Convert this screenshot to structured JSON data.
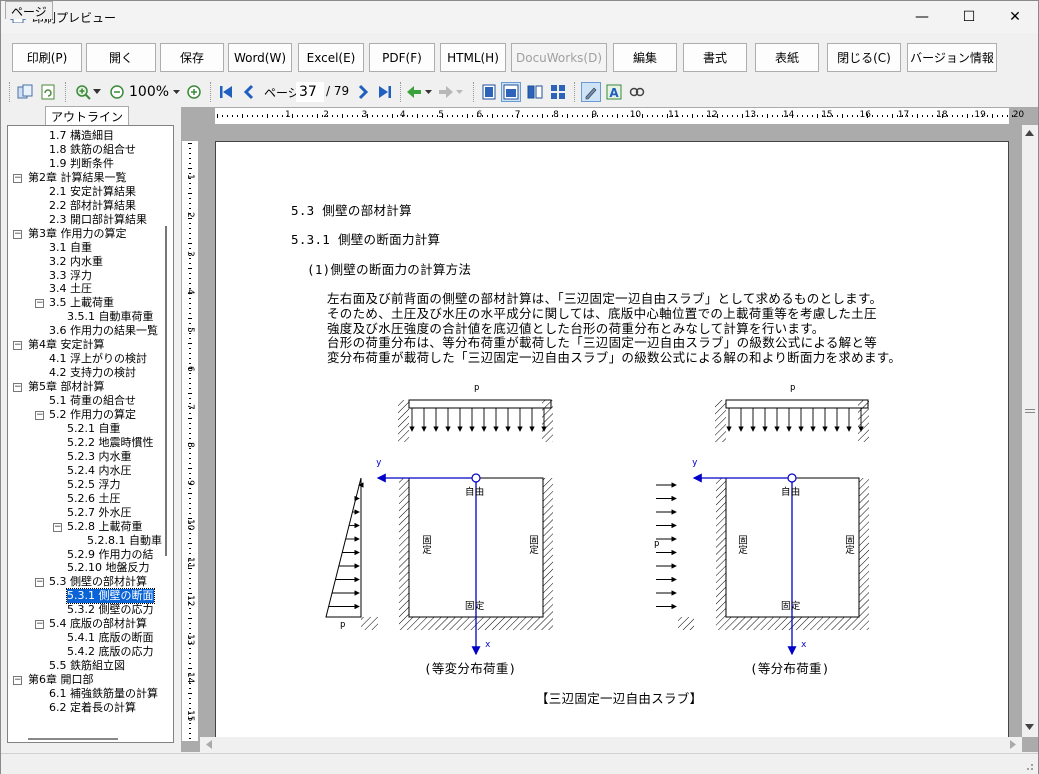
{
  "window": {
    "title": "印刷プレビュー",
    "minimize": "—",
    "maximize": "☐",
    "close": "✕"
  },
  "buttons": [
    {
      "label": "印刷(P)",
      "enabled": true
    },
    {
      "label": "開く",
      "enabled": true
    },
    {
      "label": "保存",
      "enabled": true
    },
    {
      "label": "Word(W)",
      "enabled": true
    },
    {
      "label": "Excel(E)",
      "enabled": true
    },
    {
      "label": "PDF(F)",
      "enabled": true
    },
    {
      "label": "HTML(H)",
      "enabled": true
    },
    {
      "label": "DocuWorks(D)",
      "enabled": false
    },
    {
      "label": "編集",
      "enabled": true
    },
    {
      "label": "書式",
      "enabled": true
    },
    {
      "label": "表紙",
      "enabled": true
    },
    {
      "label": "閉じる(C)",
      "enabled": true
    },
    {
      "label": "バージョン情報",
      "enabled": true
    }
  ],
  "toolbar": {
    "zoom": "100%",
    "page_label": "ページ",
    "page_current": "37",
    "page_total": "/ 79"
  },
  "tabs": [
    "ページ",
    "アウトライン"
  ],
  "tree": [
    {
      "text": "1.7 構造細目",
      "level": 1
    },
    {
      "text": "1.8 鉄筋の組合せ",
      "level": 1
    },
    {
      "text": "1.9 判断条件",
      "level": 1
    },
    {
      "text": "第2章 計算結果一覧",
      "level": 0
    },
    {
      "text": "2.1 安定計算結果",
      "level": 1
    },
    {
      "text": "2.2 部材計算結果",
      "level": 1
    },
    {
      "text": "2.3 開口部計算結果",
      "level": 1
    },
    {
      "text": "第3章 作用力の算定",
      "level": 0
    },
    {
      "text": "3.1 自重",
      "level": 1
    },
    {
      "text": "3.2 内水重",
      "level": 1
    },
    {
      "text": "3.3 浮力",
      "level": 1
    },
    {
      "text": "3.4 土圧",
      "level": 1
    },
    {
      "text": "3.5 上載荷重",
      "level": 1,
      "expander": true
    },
    {
      "text": "3.5.1 自動車荷重",
      "level": 2
    },
    {
      "text": "3.6 作用力の結果一覧",
      "level": 1
    },
    {
      "text": "第4章 安定計算",
      "level": 0
    },
    {
      "text": "4.1 浮上がりの検討",
      "level": 1
    },
    {
      "text": "4.2 支持力の検討",
      "level": 1
    },
    {
      "text": "第5章 部材計算",
      "level": 0
    },
    {
      "text": "5.1 荷重の組合せ",
      "level": 1
    },
    {
      "text": "5.2 作用力の算定",
      "level": 1,
      "expander": true
    },
    {
      "text": "5.2.1 自重",
      "level": 2
    },
    {
      "text": "5.2.2 地震時慣性",
      "level": 2
    },
    {
      "text": "5.2.3 内水重",
      "level": 2
    },
    {
      "text": "5.2.4 内水圧",
      "level": 2
    },
    {
      "text": "5.2.5 浮力",
      "level": 2
    },
    {
      "text": "5.2.6 土圧",
      "level": 2
    },
    {
      "text": "5.2.7 外水圧",
      "level": 2
    },
    {
      "text": "5.2.8 上載荷重",
      "level": 2,
      "expander": true
    },
    {
      "text": "5.2.8.1 自動車",
      "level": 3
    },
    {
      "text": "5.2.9 作用力の結",
      "level": 2
    },
    {
      "text": "5.2.10 地盤反力",
      "level": 2
    },
    {
      "text": "5.3 側壁の部材計算",
      "level": 1,
      "expander": true
    },
    {
      "text": "5.3.1 側壁の断面",
      "level": 2,
      "selected": true
    },
    {
      "text": "5.3.2 側壁の応力",
      "level": 2
    },
    {
      "text": "5.4 底版の部材計算",
      "level": 1,
      "expander": true
    },
    {
      "text": "5.4.1 底版の断面",
      "level": 2
    },
    {
      "text": "5.4.2 底版の応力",
      "level": 2
    },
    {
      "text": "5.5 鉄筋組立図",
      "level": 1
    },
    {
      "text": "第6章 開口部",
      "level": 0
    },
    {
      "text": "6.1 補強鉄筋量の計算",
      "level": 1
    },
    {
      "text": "6.2 定着長の計算",
      "level": 1
    }
  ],
  "ruler_h": [
    "1",
    "2",
    "3",
    "4",
    "5",
    "6",
    "7",
    "8",
    "9",
    "10",
    "11",
    "12",
    "13",
    "14",
    "15",
    "16",
    "17",
    "18",
    "19",
    "20"
  ],
  "ruler_v": [
    "1",
    "2",
    "3",
    "4",
    "5",
    "6",
    "7",
    "8",
    "9",
    "10",
    "11",
    "12",
    "13",
    "14",
    "15"
  ],
  "document": {
    "h1": "5.3 側壁の部材計算",
    "h2": "5.3.1 側壁の断面力計算",
    "h3": "(1)側壁の断面力の計算方法",
    "para": [
      "左右面及び前背面の側壁の部材計算は、「三辺固定一辺自由スラブ」として求めるものとします。",
      "そのため、土圧及び水圧の水平成分に関しては、底版中心軸位置での上載荷重等を考慮した土圧",
      "強度及び水圧強度の合計値を底辺値とした台形の荷重分布とみなして計算を行います。",
      "台形の荷重分布は、等分布荷重が載荷した「三辺固定一辺自由スラブ」の級数公式による解と等",
      "変分布荷重が載荷した「三辺固定一辺自由スラブ」の級数公式による解の和より断面力を求めます。"
    ],
    "diagram": {
      "p": "p",
      "y": "y",
      "x": "x",
      "free": "自由",
      "fixed": "固定",
      "caption_left": "(等変分布荷重)",
      "caption_right": "(等分布荷重)",
      "caption_main": "【三辺固定一辺自由スラブ】"
    }
  }
}
